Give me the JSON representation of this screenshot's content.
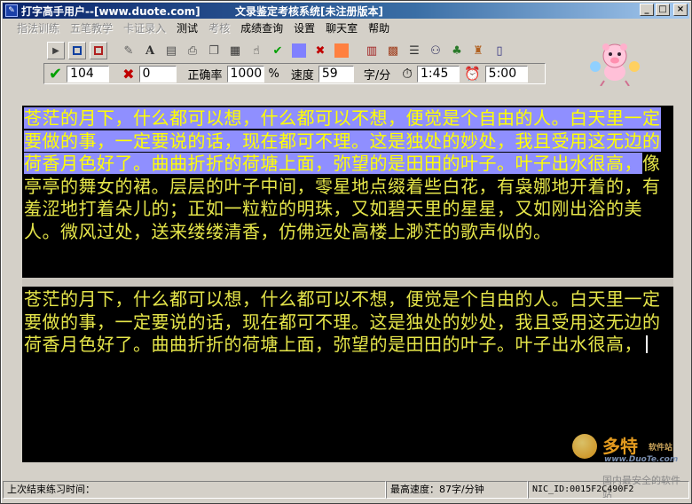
{
  "titlebar": {
    "left_title": "打字高手用户--[www.duote.com]",
    "center_title": "文录鉴定考核系统[未注册版本]",
    "buttons": [
      "_",
      "□",
      "×"
    ]
  },
  "menu": [
    {
      "label": "指法训练",
      "enabled": false
    },
    {
      "label": "五笔教学",
      "enabled": false
    },
    {
      "label": "卡证录入",
      "enabled": false
    },
    {
      "label": "测试",
      "enabled": true
    },
    {
      "label": "考核",
      "enabled": false
    },
    {
      "label": "成绩查询",
      "enabled": true
    },
    {
      "label": "设置",
      "enabled": true
    },
    {
      "label": "聊天室",
      "enabled": true
    },
    {
      "label": "帮助",
      "enabled": true
    }
  ],
  "toolbar_icons": [
    "play-icon",
    "stop-square-icon",
    "record-icon",
    "pen-icon",
    "font-icon",
    "scanner-icon",
    "print-icon",
    "clipboard-icon",
    "keyboard-icon",
    "pointer-icon",
    "check-icon",
    "blue-square-icon",
    "cross-icon",
    "orange-square-icon",
    "chart-icon",
    "grid-icon",
    "list-icon",
    "network-icon",
    "tree-icon",
    "gift-icon",
    "door-icon"
  ],
  "stats": {
    "correct": "104",
    "errors": "0",
    "accuracy_label": "正确率",
    "accuracy": "1000",
    "percent": "%",
    "speed_label": "速度",
    "speed": "59",
    "speed_unit": "字/分",
    "elapsed": "1:45",
    "limit": "5:00"
  },
  "source_text": {
    "typed": "苍茫的月下，什么都可以想，什么都可以不想，便觉是个自由的人。白天里一定要做的事，一定要说的话，现在都可不理。这是独处的妙处，我且受用这无边的荷香月色好了。曲曲折折的荷塘上面，弥望的是田田的叶子。叶子出水很高，",
    "remaining": "像亭亭的舞女的裙。层层的叶子中间，零星地点缀着些白花，有袅娜地开着的，有羞涩地打着朵儿的；正如一粒粒的明珠，又如碧天里的星星，又如刚出浴的美人。微风过处，送来缕缕清香，仿佛远处高楼上渺茫的歌声似的。"
  },
  "input_text": "苍茫的月下，什么都可以想，什么都可以不想，便觉是个自由的人。白天里一定要做的事，一定要说的话，现在都可不理。这是独处的妙处，我且受用这无边的荷香月色好了。曲曲折折的荷塘上面，弥望的是田田的叶子。叶子出水很高，",
  "watermark": {
    "brand": "多特",
    "brand_small": "软件站",
    "url": "www.DuoTe.com",
    "slogan": "国内最安全的软件站"
  },
  "statusbar": {
    "last_practice": "上次结束练习时间：",
    "best_speed": "最高速度：87字/分钟",
    "nic_id": "NIC_ID:0015F2C490F2"
  },
  "colors": {
    "title_start": "#0a246a",
    "title_end": "#a6caf0",
    "text_yellow": "#e6e64a",
    "highlight": "#8f8fff",
    "panel_bg": "#000000"
  }
}
